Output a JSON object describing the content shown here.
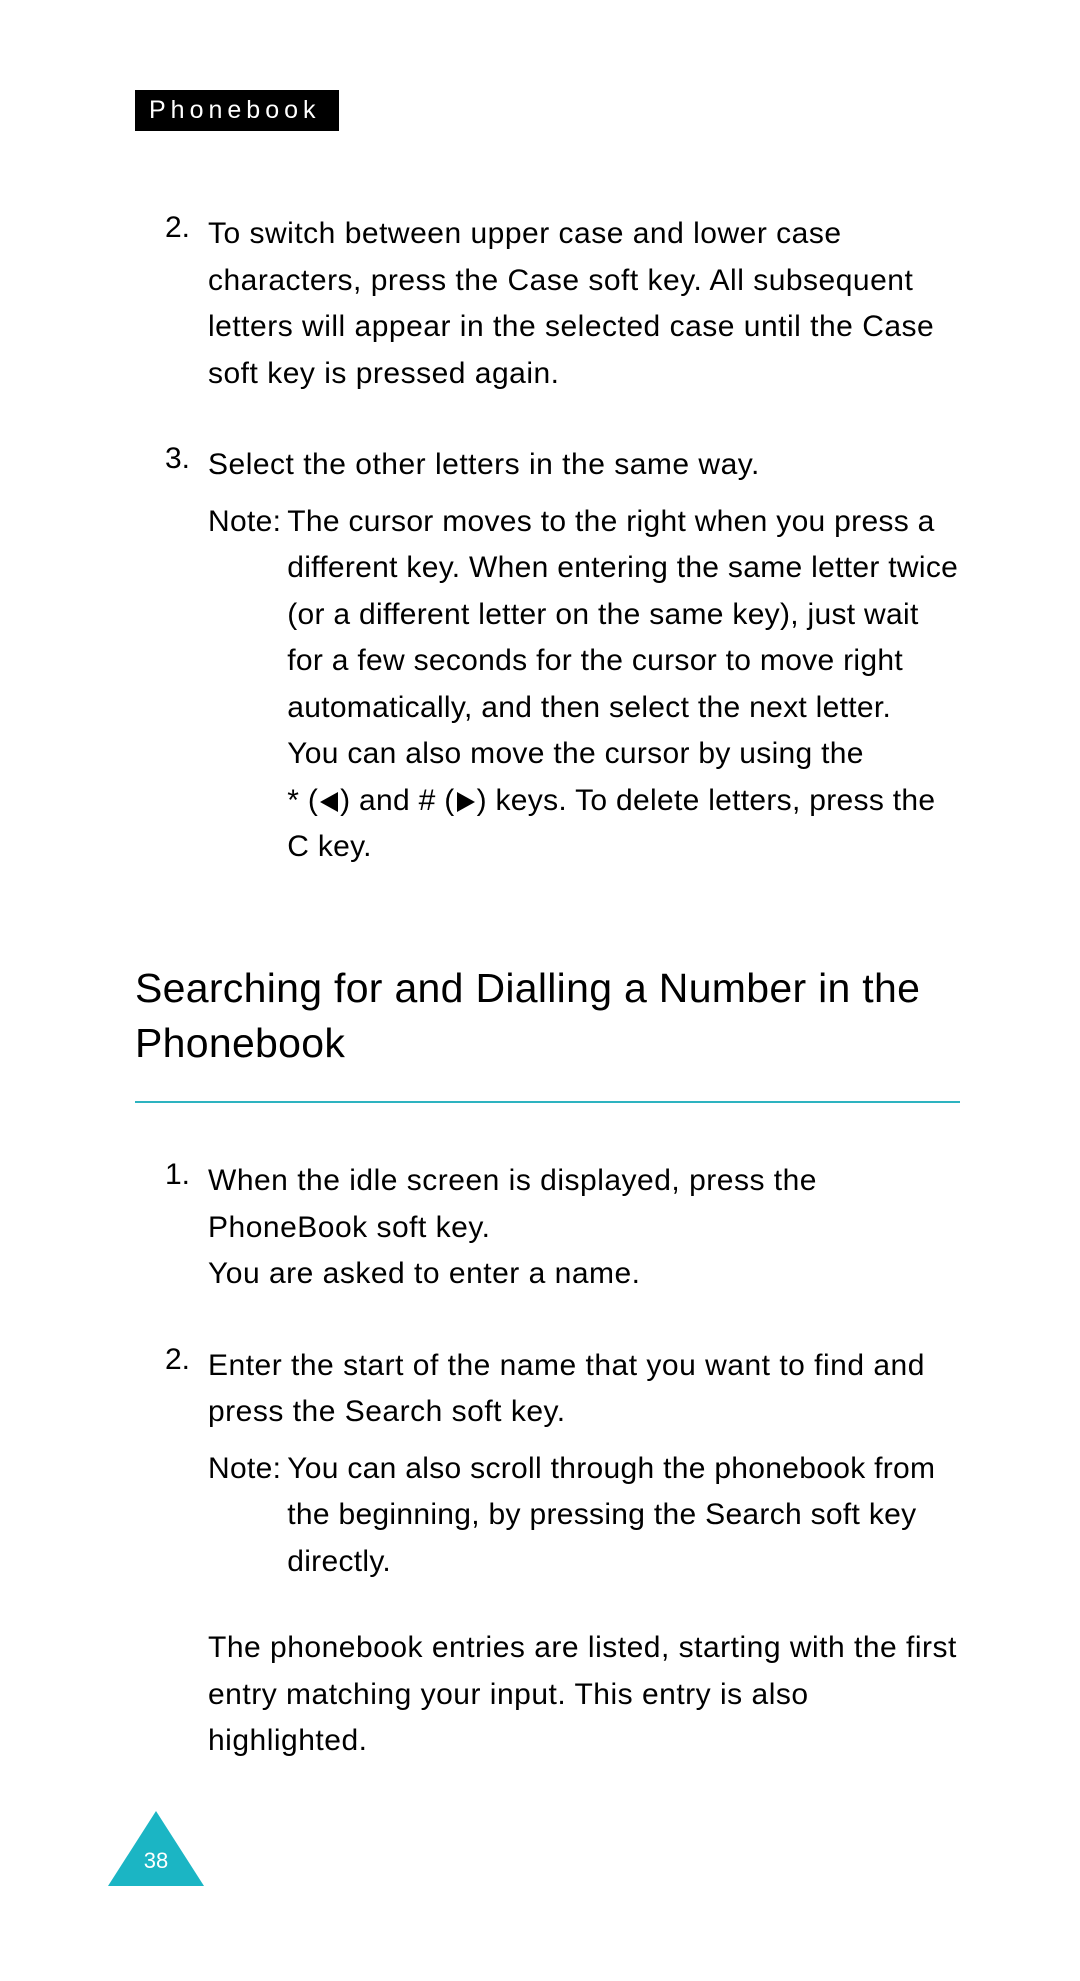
{
  "header": {
    "tag": "Phonebook"
  },
  "section1": {
    "items": [
      {
        "num": "2.",
        "text_parts": [
          "To switch between upper case and lower case characters, press the ",
          "Case",
          " soft key. All subsequent letters will appear in the selected case until the ",
          "Case",
          " soft key is pressed again."
        ]
      },
      {
        "num": "3.",
        "text": "Select the other letters in the same way.",
        "note_label": "Note:",
        "note_body1": "The cursor moves to the right when you press a different key. When entering the same letter twice (or a different letter on the same key), just wait for a few seconds for the cursor to move right automatically, and then select the next letter.",
        "note_body2": "You can also move the cursor by using the",
        "note_body3_pre": "* (",
        "note_body3_mid": ") and # (",
        "note_body3_post": ") keys. To delete letters, press the ",
        "note_body3_key": "C",
        "note_body3_end": " key."
      }
    ]
  },
  "heading": "Searching for and Dialling a Number in the Phonebook",
  "section2": {
    "items": [
      {
        "num": "1.",
        "line1_pre": "When the idle screen is displayed, press the ",
        "line1_key": "PhoneBook",
        "line1_post": " soft key.",
        "line2": "You are asked to enter a name."
      },
      {
        "num": "2.",
        "line1_pre": "Enter the start of the name that you want to find and press the ",
        "line1_key": "Search",
        "line1_post": " soft key.",
        "note_label": "Note:",
        "note_body": "You can also scroll through the phonebook from the beginning, by pressing the Search soft key directly.",
        "result": "The phonebook entries are listed, starting with the first entry matching your input. This entry is also highlighted."
      }
    ]
  },
  "page_number": "38"
}
